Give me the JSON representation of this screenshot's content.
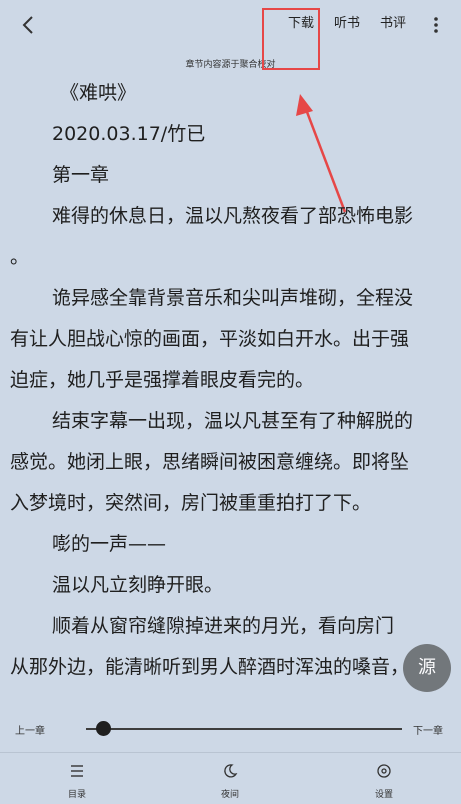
{
  "topbar": {
    "back_icon": "chevron-left-icon",
    "actions": [
      {
        "label": "下载"
      },
      {
        "label": "听书"
      },
      {
        "label": "书评"
      }
    ],
    "more_icon": "more-vertical-icon"
  },
  "source_note": "章节内容源于聚合校对",
  "content_lines": [
    "《难哄》",
    "2020.03.17/竹已",
    "第一章",
    "难得的休息日，温以凡熬夜看了部恐怖电影",
    "。",
    "诡异感全靠背景音乐和尖叫声堆砌，全程没",
    "有让人胆战心惊的画面，平淡如白开水。出于强",
    "迫症，她几乎是强撑着眼皮看完的。",
    "结束字幕一出现，温以凡甚至有了种解脱的",
    "感觉。她闭上眼，思绪瞬间被困意缠绕。即将坠",
    "入梦境时，突然间，房门被重重拍打了下。",
    "嘭的一声——",
    "温以凡立刻睁开眼。",
    "顺着从窗帘缝隙掉进来的月光，看向房门",
    "从那外边，能清晰听到男人醉酒时浑浊的嗓音，"
  ],
  "reader": {
    "prev_chapter": "上一章",
    "next_chapter": "下一章",
    "progress_fraction": 0.03,
    "source_button": "源"
  },
  "bottom_nav": [
    {
      "label": "目录",
      "icon": "menu-list-icon"
    },
    {
      "label": "夜间",
      "icon": "moon-icon"
    },
    {
      "label": "设置",
      "icon": "settings-circle-icon"
    }
  ],
  "colors": {
    "background": "#cdd8e6",
    "text": "#1f1f1f",
    "annotation": "#e64747",
    "fab": "#6b6f73"
  }
}
